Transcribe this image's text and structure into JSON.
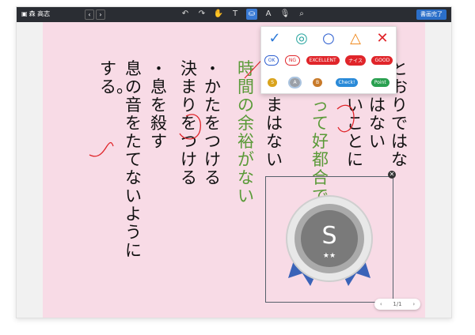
{
  "app": {
    "user_name": "森 高志",
    "done_label": "書画完了"
  },
  "nav": {
    "prev": "‹",
    "next": "›"
  },
  "toolbar": {
    "undo": "↶",
    "redo": "↷",
    "hand": "✋",
    "text": "T",
    "stamp": "⛀",
    "pen": "A",
    "mic": "🎙",
    "zoom": "⌕"
  },
  "columns": [
    "とおりではな",
    "通ではない",
    "をよいことに",
    "にとって好都合である",
    "いとまはない",
    "時間の余裕がない",
    "・かたをつける",
    "決まりをつける",
    "・息を殺す",
    "息の音をたてないように",
    "する。"
  ],
  "palette": {
    "row1": [
      "✓",
      "◎",
      "○",
      "△",
      "✕"
    ],
    "row2": [
      "OK",
      "NG",
      "EXCELLENT",
      "ナイス",
      "GOOD"
    ],
    "row3": [
      "S",
      "A",
      "B",
      "Check!",
      "Point"
    ]
  },
  "medal": {
    "letter": "S",
    "stars": "★★"
  },
  "pager": {
    "prev": "‹",
    "text": "1/1",
    "next": "›"
  },
  "colors": {
    "canvas": "#f8dbe6",
    "accent": "#3a7bd5",
    "green_text": "#5a9a38",
    "ink_red": "#e0252a"
  }
}
